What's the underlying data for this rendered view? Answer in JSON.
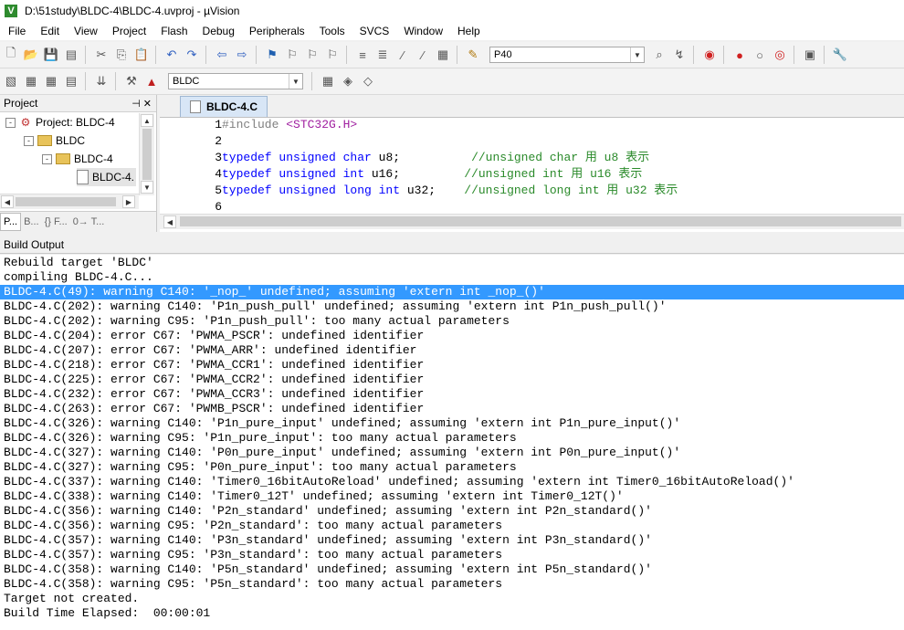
{
  "window": {
    "title": "D:\\51study\\BLDC-4\\BLDC-4.uvproj - µVision",
    "app_icon": "V"
  },
  "menu": [
    "File",
    "Edit",
    "View",
    "Project",
    "Flash",
    "Debug",
    "Peripherals",
    "Tools",
    "SVCS",
    "Window",
    "Help"
  ],
  "toolbar1": {
    "find_combo": "P40"
  },
  "toolbar2": {
    "target_combo": "BLDC"
  },
  "project_panel": {
    "title": "Project",
    "tree": [
      {
        "label": "Project: BLDC-4",
        "expander": "-"
      },
      {
        "label": "BLDC",
        "expander": "-"
      },
      {
        "label": "BLDC-4",
        "expander": "-"
      },
      {
        "label": "BLDC-4."
      }
    ],
    "tabs": [
      "P...",
      "B...",
      "{} F...",
      "0→ T..."
    ]
  },
  "editor": {
    "tab": "BLDC-4.C",
    "lines": [
      {
        "num": "1",
        "parts": [
          [
            "pp",
            "#include "
          ],
          [
            "str",
            "<STC32G.H>"
          ]
        ]
      },
      {
        "num": "2",
        "parts": []
      },
      {
        "num": "3",
        "parts": [
          [
            "kw",
            "typedef unsigned char"
          ],
          [
            "",
            "u8;          "
          ],
          [
            "cm",
            "//unsigned char 用 u8 表示"
          ]
        ]
      },
      {
        "num": "4",
        "parts": [
          [
            "kw",
            "typedef unsigned int"
          ],
          [
            "",
            "u16;         "
          ],
          [
            "cm",
            "//unsigned int 用 u16 表示"
          ]
        ]
      },
      {
        "num": "5",
        "parts": [
          [
            "kw",
            "typedef unsigned long int"
          ],
          [
            "",
            "u32;    "
          ],
          [
            "cm",
            "//unsigned long int 用 u32 表示"
          ]
        ]
      },
      {
        "num": "6",
        "parts": []
      }
    ]
  },
  "build_output": {
    "title": "Build Output",
    "selected_index": 2,
    "lines": [
      "Rebuild target 'BLDC'",
      "compiling BLDC-4.C...",
      "BLDC-4.C(49): warning C140: '_nop_' undefined; assuming 'extern int _nop_()'",
      "BLDC-4.C(202): warning C140: 'P1n_push_pull' undefined; assuming 'extern int P1n_push_pull()'",
      "BLDC-4.C(202): warning C95: 'P1n_push_pull': too many actual parameters",
      "BLDC-4.C(204): error C67: 'PWMA_PSCR': undefined identifier",
      "BLDC-4.C(207): error C67: 'PWMA_ARR': undefined identifier",
      "BLDC-4.C(218): error C67: 'PWMA_CCR1': undefined identifier",
      "BLDC-4.C(225): error C67: 'PWMA_CCR2': undefined identifier",
      "BLDC-4.C(232): error C67: 'PWMA_CCR3': undefined identifier",
      "BLDC-4.C(263): error C67: 'PWMB_PSCR': undefined identifier",
      "BLDC-4.C(326): warning C140: 'P1n_pure_input' undefined; assuming 'extern int P1n_pure_input()'",
      "BLDC-4.C(326): warning C95: 'P1n_pure_input': too many actual parameters",
      "BLDC-4.C(327): warning C140: 'P0n_pure_input' undefined; assuming 'extern int P0n_pure_input()'",
      "BLDC-4.C(327): warning C95: 'P0n_pure_input': too many actual parameters",
      "BLDC-4.C(337): warning C140: 'Timer0_16bitAutoReload' undefined; assuming 'extern int Timer0_16bitAutoReload()'",
      "BLDC-4.C(338): warning C140: 'Timer0_12T' undefined; assuming 'extern int Timer0_12T()'",
      "BLDC-4.C(356): warning C140: 'P2n_standard' undefined; assuming 'extern int P2n_standard()'",
      "BLDC-4.C(356): warning C95: 'P2n_standard': too many actual parameters",
      "BLDC-4.C(357): warning C140: 'P3n_standard' undefined; assuming 'extern int P3n_standard()'",
      "BLDC-4.C(357): warning C95: 'P3n_standard': too many actual parameters",
      "BLDC-4.C(358): warning C140: 'P5n_standard' undefined; assuming 'extern int P5n_standard()'",
      "BLDC-4.C(358): warning C95: 'P5n_standard': too many actual parameters",
      "Target not created.",
      "Build Time Elapsed:  00:00:01"
    ]
  },
  "icons": {
    "toolbar1": [
      "new-file-icon",
      "open-file-icon",
      "save-icon",
      "save-all-icon",
      "cut-icon",
      "copy-icon",
      "paste-icon",
      "undo-icon",
      "redo-icon",
      "nav-back-icon",
      "nav-forward-icon",
      "bookmark-icon",
      "prev-bookmark-icon",
      "next-bookmark-icon",
      "clear-bookmarks-icon",
      "indent-icon",
      "unindent-icon",
      "comment-icon",
      "uncomment-icon",
      "find-in-files-icon"
    ],
    "toolbar1_right": [
      "incremental-find-icon",
      "find-icon",
      "debug-icon",
      "breakpoint-icon",
      "disable-breakpoint-icon",
      "kill-breakpoints-icon",
      "window-config-icon",
      "configure-icon"
    ],
    "toolbar2": [
      "translate-icon",
      "build-icon",
      "rebuild-icon",
      "batch-build-icon",
      "download-icon",
      "target-options-icon",
      "manage-project-icon",
      "packs-icon",
      "rte-icon",
      "pack-installer-icon"
    ]
  },
  "colors": {
    "selection": "#3399ff",
    "keyword": "#0000ff",
    "comment": "#2a8a2a",
    "include_path": "#a020a0"
  }
}
